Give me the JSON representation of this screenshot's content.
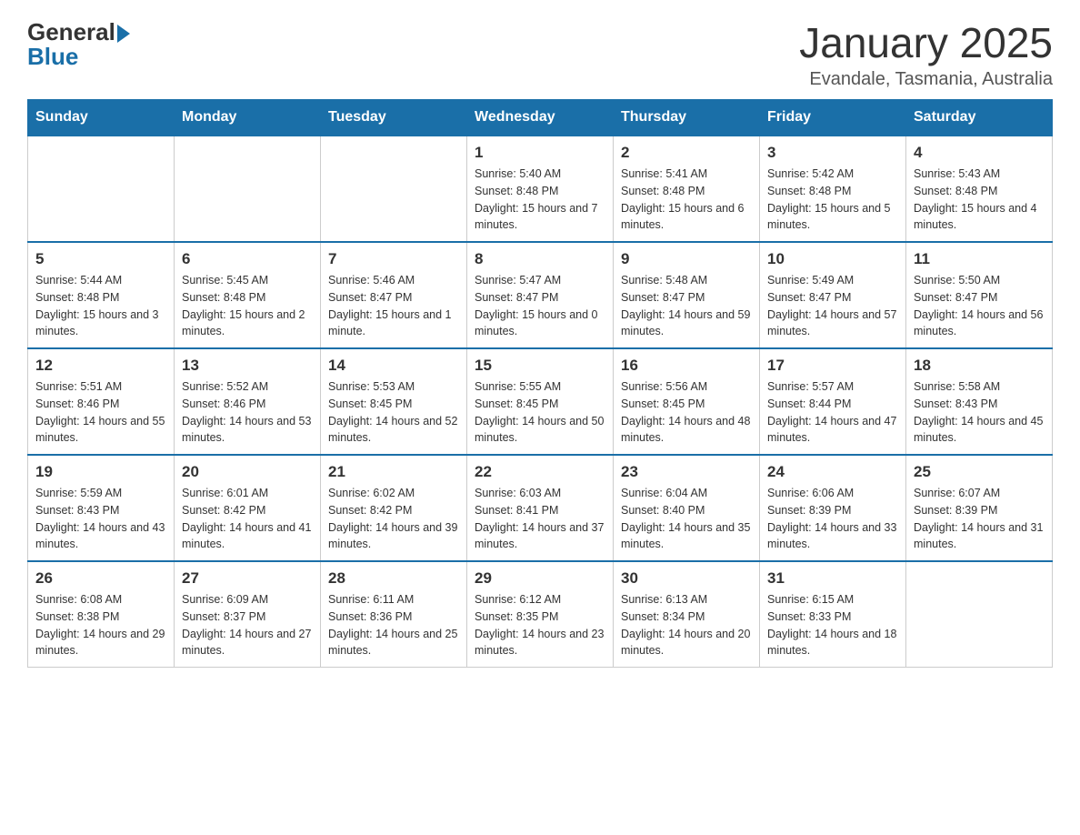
{
  "logo": {
    "general": "General",
    "blue": "Blue"
  },
  "title": "January 2025",
  "subtitle": "Evandale, Tasmania, Australia",
  "days_of_week": [
    "Sunday",
    "Monday",
    "Tuesday",
    "Wednesday",
    "Thursday",
    "Friday",
    "Saturday"
  ],
  "weeks": [
    [
      {
        "day": "",
        "info": ""
      },
      {
        "day": "",
        "info": ""
      },
      {
        "day": "",
        "info": ""
      },
      {
        "day": "1",
        "info": "Sunrise: 5:40 AM\nSunset: 8:48 PM\nDaylight: 15 hours and 7 minutes."
      },
      {
        "day": "2",
        "info": "Sunrise: 5:41 AM\nSunset: 8:48 PM\nDaylight: 15 hours and 6 minutes."
      },
      {
        "day": "3",
        "info": "Sunrise: 5:42 AM\nSunset: 8:48 PM\nDaylight: 15 hours and 5 minutes."
      },
      {
        "day": "4",
        "info": "Sunrise: 5:43 AM\nSunset: 8:48 PM\nDaylight: 15 hours and 4 minutes."
      }
    ],
    [
      {
        "day": "5",
        "info": "Sunrise: 5:44 AM\nSunset: 8:48 PM\nDaylight: 15 hours and 3 minutes."
      },
      {
        "day": "6",
        "info": "Sunrise: 5:45 AM\nSunset: 8:48 PM\nDaylight: 15 hours and 2 minutes."
      },
      {
        "day": "7",
        "info": "Sunrise: 5:46 AM\nSunset: 8:47 PM\nDaylight: 15 hours and 1 minute."
      },
      {
        "day": "8",
        "info": "Sunrise: 5:47 AM\nSunset: 8:47 PM\nDaylight: 15 hours and 0 minutes."
      },
      {
        "day": "9",
        "info": "Sunrise: 5:48 AM\nSunset: 8:47 PM\nDaylight: 14 hours and 59 minutes."
      },
      {
        "day": "10",
        "info": "Sunrise: 5:49 AM\nSunset: 8:47 PM\nDaylight: 14 hours and 57 minutes."
      },
      {
        "day": "11",
        "info": "Sunrise: 5:50 AM\nSunset: 8:47 PM\nDaylight: 14 hours and 56 minutes."
      }
    ],
    [
      {
        "day": "12",
        "info": "Sunrise: 5:51 AM\nSunset: 8:46 PM\nDaylight: 14 hours and 55 minutes."
      },
      {
        "day": "13",
        "info": "Sunrise: 5:52 AM\nSunset: 8:46 PM\nDaylight: 14 hours and 53 minutes."
      },
      {
        "day": "14",
        "info": "Sunrise: 5:53 AM\nSunset: 8:45 PM\nDaylight: 14 hours and 52 minutes."
      },
      {
        "day": "15",
        "info": "Sunrise: 5:55 AM\nSunset: 8:45 PM\nDaylight: 14 hours and 50 minutes."
      },
      {
        "day": "16",
        "info": "Sunrise: 5:56 AM\nSunset: 8:45 PM\nDaylight: 14 hours and 48 minutes."
      },
      {
        "day": "17",
        "info": "Sunrise: 5:57 AM\nSunset: 8:44 PM\nDaylight: 14 hours and 47 minutes."
      },
      {
        "day": "18",
        "info": "Sunrise: 5:58 AM\nSunset: 8:43 PM\nDaylight: 14 hours and 45 minutes."
      }
    ],
    [
      {
        "day": "19",
        "info": "Sunrise: 5:59 AM\nSunset: 8:43 PM\nDaylight: 14 hours and 43 minutes."
      },
      {
        "day": "20",
        "info": "Sunrise: 6:01 AM\nSunset: 8:42 PM\nDaylight: 14 hours and 41 minutes."
      },
      {
        "day": "21",
        "info": "Sunrise: 6:02 AM\nSunset: 8:42 PM\nDaylight: 14 hours and 39 minutes."
      },
      {
        "day": "22",
        "info": "Sunrise: 6:03 AM\nSunset: 8:41 PM\nDaylight: 14 hours and 37 minutes."
      },
      {
        "day": "23",
        "info": "Sunrise: 6:04 AM\nSunset: 8:40 PM\nDaylight: 14 hours and 35 minutes."
      },
      {
        "day": "24",
        "info": "Sunrise: 6:06 AM\nSunset: 8:39 PM\nDaylight: 14 hours and 33 minutes."
      },
      {
        "day": "25",
        "info": "Sunrise: 6:07 AM\nSunset: 8:39 PM\nDaylight: 14 hours and 31 minutes."
      }
    ],
    [
      {
        "day": "26",
        "info": "Sunrise: 6:08 AM\nSunset: 8:38 PM\nDaylight: 14 hours and 29 minutes."
      },
      {
        "day": "27",
        "info": "Sunrise: 6:09 AM\nSunset: 8:37 PM\nDaylight: 14 hours and 27 minutes."
      },
      {
        "day": "28",
        "info": "Sunrise: 6:11 AM\nSunset: 8:36 PM\nDaylight: 14 hours and 25 minutes."
      },
      {
        "day": "29",
        "info": "Sunrise: 6:12 AM\nSunset: 8:35 PM\nDaylight: 14 hours and 23 minutes."
      },
      {
        "day": "30",
        "info": "Sunrise: 6:13 AM\nSunset: 8:34 PM\nDaylight: 14 hours and 20 minutes."
      },
      {
        "day": "31",
        "info": "Sunrise: 6:15 AM\nSunset: 8:33 PM\nDaylight: 14 hours and 18 minutes."
      },
      {
        "day": "",
        "info": ""
      }
    ]
  ]
}
